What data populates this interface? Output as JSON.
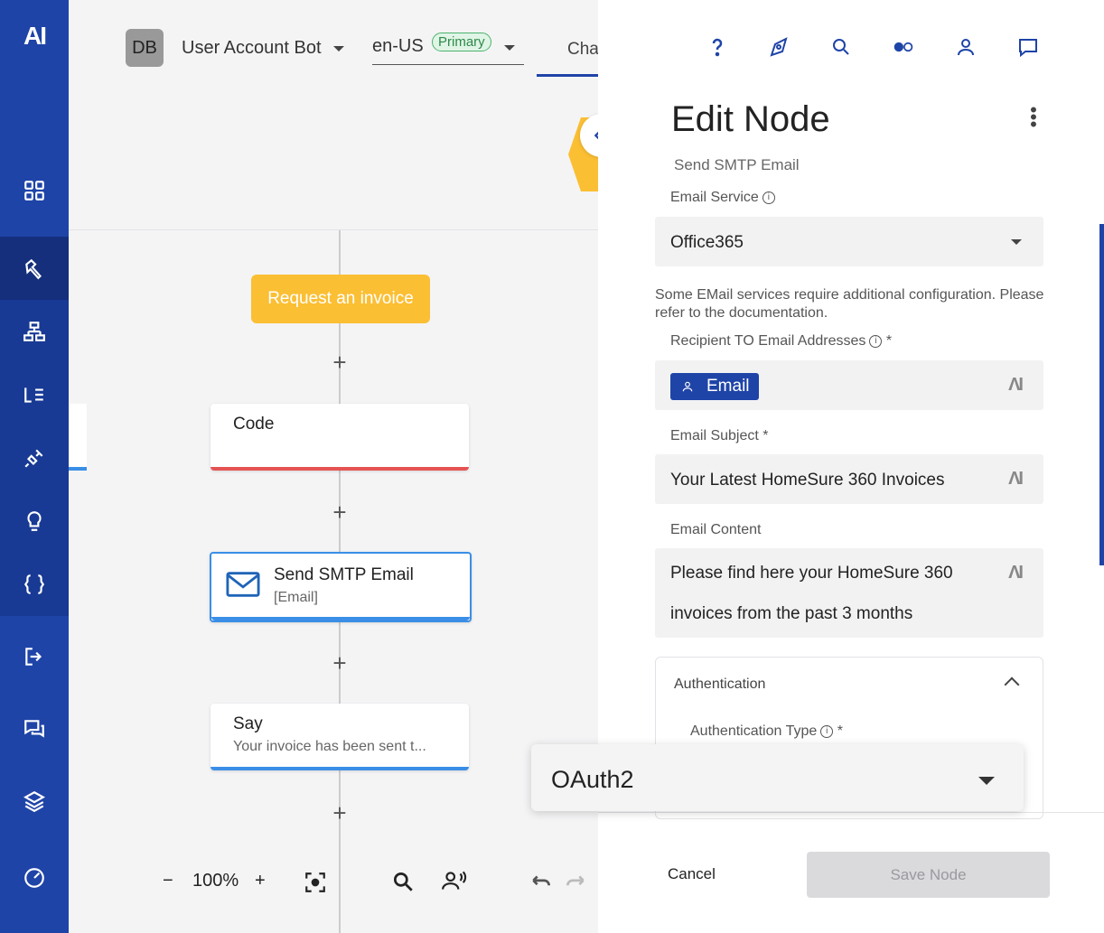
{
  "nav": {
    "logo": "AI",
    "items": [
      "dashboard",
      "build",
      "flows",
      "lexicons",
      "extensions",
      "insights",
      "code",
      "deploy",
      "conversations",
      "layers",
      "manage"
    ]
  },
  "header": {
    "avatar_initials": "DB",
    "bot_name": "User Account Bot",
    "locale_code": "en-US",
    "locale_badge": "Primary",
    "tab_peek": "Cha"
  },
  "flow": {
    "start_label": "Request an invoice",
    "nodes": [
      {
        "title": "Code",
        "subtitle": "",
        "bar_color": "#e55353"
      },
      {
        "title": "Send SMTP Email",
        "subtitle": "[Email]",
        "bar_color": "#3a8ee6"
      },
      {
        "title": "Say",
        "subtitle": "Your invoice has been sent t...",
        "bar_color": "#3a8ee6"
      }
    ],
    "zoom": "100%",
    "zoom_minus": "−",
    "zoom_plus": "+"
  },
  "panel": {
    "title": "Edit Node",
    "subtitle": "Send SMTP Email",
    "email_service_label": "Email Service",
    "email_service_value": "Office365",
    "note": "Some EMail services require additional configuration. Please refer to the documentation.",
    "recipient_label": "Recipient TO Email Addresses",
    "required_mark": "*",
    "recipient_chip": "Email",
    "subject_label": "Email Subject *",
    "subject_value": "Your Latest HomeSure 360 Invoices",
    "content_label": "Email Content",
    "content_line1": "Please find here your HomeSure 360",
    "content_line2": "invoices from the past 3 months",
    "ai_glyph": "ΛI",
    "auth_header": "Authentication",
    "auth_type_label": "Authentication Type",
    "auth_type_value": "OAuth2",
    "cancel_label": "Cancel",
    "save_label": "Save Node"
  },
  "colors": {
    "brand": "#1f44a8",
    "accent_yellow": "#fbbf34",
    "primary_badge": "#4db36d"
  }
}
